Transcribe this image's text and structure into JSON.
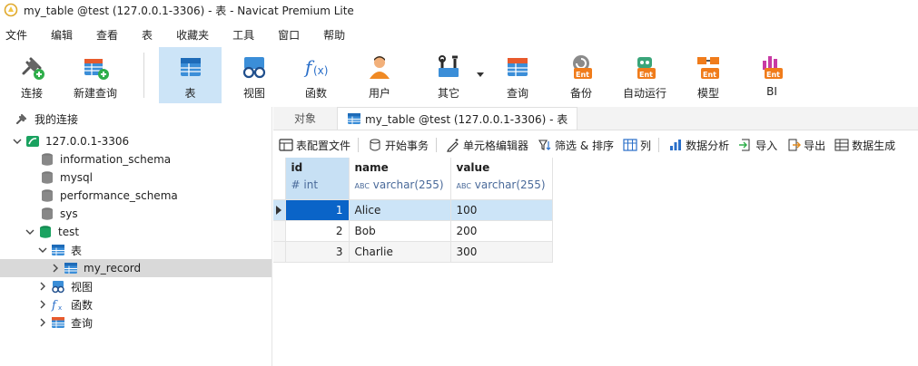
{
  "window": {
    "title": "my_table @test (127.0.0.1-3306) - 表 - Navicat Premium Lite"
  },
  "menu": [
    "文件",
    "编辑",
    "查看",
    "表",
    "收藏夹",
    "工具",
    "窗口",
    "帮助"
  ],
  "toolbar": {
    "items": [
      {
        "label": "连接",
        "icon": "plug-icon"
      },
      {
        "label": "新建查询",
        "icon": "new-query-icon"
      },
      {
        "label": "表",
        "icon": "table-icon",
        "active": true
      },
      {
        "label": "视图",
        "icon": "view-glasses-icon"
      },
      {
        "label": "函数",
        "icon": "function-icon"
      },
      {
        "label": "用户",
        "icon": "user-icon"
      },
      {
        "label": "其它",
        "icon": "tools-icon"
      },
      {
        "label": "查询",
        "icon": "query-icon"
      },
      {
        "label": "备份",
        "icon": "backup-ent-icon"
      },
      {
        "label": "自动运行",
        "icon": "robot-ent-icon"
      },
      {
        "label": "模型",
        "icon": "model-ent-icon"
      },
      {
        "label": "BI",
        "icon": "bi-ent-icon"
      }
    ],
    "ent_badge": "Ent"
  },
  "nav": {
    "root": "我的连接",
    "connection": "127.0.0.1-3306",
    "databases": [
      "information_schema",
      "mysql",
      "performance_schema",
      "sys",
      "test"
    ],
    "test_children": {
      "tables_label": "表",
      "table": "my_record",
      "views_label": "视图",
      "functions_label": "函数",
      "queries_label": "查询"
    }
  },
  "tabs": {
    "objects": "对象",
    "active": "my_table @test (127.0.0.1-3306) - 表"
  },
  "subtoolbar": {
    "design": "表配置文件",
    "transaction": "开始事务",
    "cell_editor": "单元格编辑器",
    "filter_sort": "筛选 & 排序",
    "columns": "列",
    "analysis": "数据分析",
    "import": "导入",
    "export": "导出",
    "generate": "数据生成"
  },
  "grid": {
    "columns": [
      {
        "name": "id",
        "type": "int",
        "type_prefix": "#"
      },
      {
        "name": "name",
        "type": "varchar(255)",
        "type_prefix": "ABC"
      },
      {
        "name": "value",
        "type": "varchar(255)",
        "type_prefix": "ABC"
      }
    ],
    "rows": [
      {
        "id": "1",
        "name": "Alice",
        "value": "100"
      },
      {
        "id": "2",
        "name": "Bob",
        "value": "200"
      },
      {
        "id": "3",
        "name": "Charlie",
        "value": "300"
      }
    ],
    "selected_row": 0
  },
  "colors": {
    "accent": "#0a64c8",
    "selection": "#cce4f7",
    "toolbar_active": "#cce4f7",
    "db_green": "#1aa260"
  }
}
